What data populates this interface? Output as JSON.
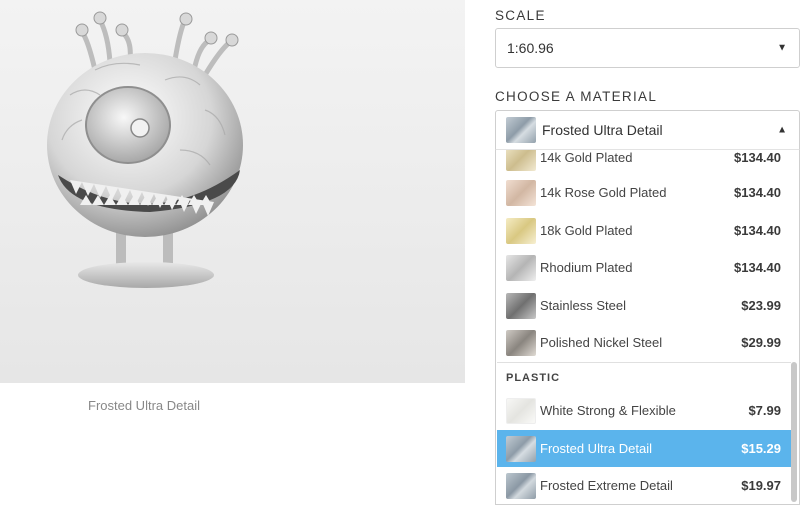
{
  "preview": {
    "caption": "Frosted Ultra Detail"
  },
  "scale": {
    "label": "SCALE",
    "value": "1:60.96"
  },
  "material": {
    "label": "CHOOSE A MATERIAL",
    "selected": "Frosted Ultra Detail",
    "metal_options": [
      {
        "name": "14k Gold Plated",
        "price": "$134.40",
        "swatch": "#e8dcc0"
      },
      {
        "name": "14k Rose Gold Plated",
        "price": "$134.40",
        "swatch": "#ead4c4"
      },
      {
        "name": "18k Gold Plated",
        "price": "$134.40",
        "swatch": "#eee2b4"
      },
      {
        "name": "Rhodium Plated",
        "price": "$134.40",
        "swatch": "#d4d4d4"
      },
      {
        "name": "Stainless Steel",
        "price": "$23.99",
        "swatch": "#9a9a9a"
      },
      {
        "name": "Polished Nickel Steel",
        "price": "$29.99",
        "swatch": "#b3b0ac"
      }
    ],
    "plastic_group_label": "PLASTIC",
    "plastic_options": [
      {
        "name": "White Strong & Flexible",
        "price": "$7.99",
        "swatch": "#f2f2f0"
      },
      {
        "name": "Frosted Ultra Detail",
        "price": "$15.29",
        "swatch": "#aab8c2"
      },
      {
        "name": "Frosted Extreme Detail",
        "price": "$19.97",
        "swatch": "#a6b4be"
      }
    ]
  },
  "colors": {
    "selected_row": "#5bb4ec",
    "text": "#333333"
  }
}
